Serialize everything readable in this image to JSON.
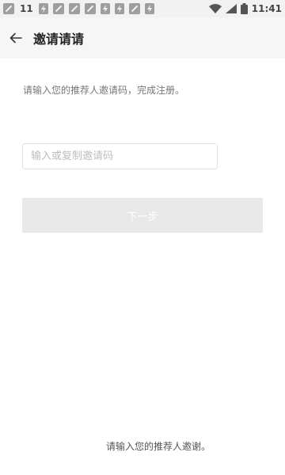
{
  "status_bar": {
    "notification_count": "11",
    "time": "11:41",
    "icons": [
      "notification-icon",
      "notification-icon",
      "flash-icon",
      "notification-icon",
      "notification-icon",
      "notification-icon",
      "flash-icon",
      "flash-icon",
      "notification-icon",
      "flash-icon",
      "wifi-icon",
      "signal-icon",
      "battery-icon"
    ]
  },
  "header": {
    "title": "邀请请请",
    "back_icon": "arrow-left-icon"
  },
  "main": {
    "instruction": "请输入您的推荐人邀请码，完成注册。",
    "input_placeholder": "输入或复制邀请码",
    "input_value": "",
    "next_label": "下一步"
  },
  "footer": {
    "text": "请输入您的推荐人邀谢。"
  },
  "colors": {
    "button_background": "#e8e8e8",
    "button_text": "#ffffff",
    "app_bar_background": "#f6f6f6"
  }
}
